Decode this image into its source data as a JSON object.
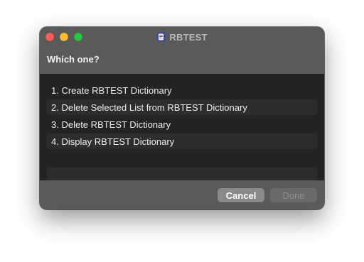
{
  "window": {
    "title": "RBTEST",
    "app_icon": "script-app-icon"
  },
  "dialog": {
    "prompt": "Which one?",
    "items": [
      "1. Create RBTEST Dictionary",
      "2. Delete Selected List from RBTEST Dictionary",
      "3. Delete RBTEST Dictionary",
      "4. Display RBTEST Dictionary",
      ""
    ],
    "selected_index": null
  },
  "buttons": {
    "cancel_label": "Cancel",
    "done_label": "Done",
    "done_enabled": false
  },
  "colors": {
    "window_bg": "#5a5a5a",
    "list_bg": "#232323",
    "alt_row": "#2d2d2d",
    "close": "#ff5f57",
    "minimize": "#febc2e",
    "zoom": "#28c840"
  }
}
